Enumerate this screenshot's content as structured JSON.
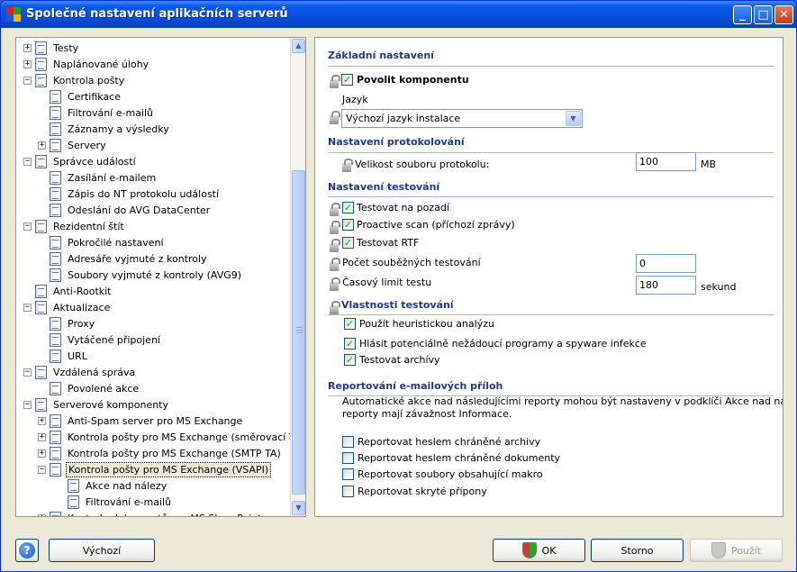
{
  "window": {
    "title": "Společné nastavení aplikačních serverů",
    "minimize": "_",
    "maximize": "□",
    "close": "✕"
  },
  "brand_colors": [
    "#d9232a",
    "#2a9d2a",
    "#1f5bc8",
    "#f2b705"
  ],
  "tree": [
    {
      "label": "Testy",
      "level": 0,
      "expander": "+",
      "icon": "search-icon"
    },
    {
      "label": "Naplánované úlohy",
      "level": 0,
      "expander": "+",
      "icon": "schedule-icon"
    },
    {
      "label": "Kontrola pošty",
      "level": 0,
      "expander": "−",
      "icon": "document-icon"
    },
    {
      "label": "Certifikace",
      "level": 1,
      "expander": "",
      "icon": "document-icon"
    },
    {
      "label": "Filtrování e-mailů",
      "level": 1,
      "expander": "",
      "icon": "document-icon"
    },
    {
      "label": "Záznamy a výsledky",
      "level": 1,
      "expander": "",
      "icon": "document-icon"
    },
    {
      "label": "Servery",
      "level": 1,
      "expander": "+",
      "icon": "server-icon"
    },
    {
      "label": "Správce událostí",
      "level": 0,
      "expander": "−",
      "icon": "document-icon"
    },
    {
      "label": "Zasílání e-mailem",
      "level": 1,
      "expander": "",
      "icon": "document-icon"
    },
    {
      "label": "Zápis do NT protokolu událostí",
      "level": 1,
      "expander": "",
      "icon": "document-icon"
    },
    {
      "label": "Odeslání do AVG DataCenter",
      "level": 1,
      "expander": "",
      "icon": "document-icon"
    },
    {
      "label": "Rezidentní štít",
      "level": 0,
      "expander": "−",
      "icon": "document-icon"
    },
    {
      "label": "Pokročilé nastavení",
      "level": 1,
      "expander": "",
      "icon": "document-icon"
    },
    {
      "label": "Adresáře vyjmuté z kontroly",
      "level": 1,
      "expander": "",
      "icon": "document-icon"
    },
    {
      "label": "Soubory vyjmuté z kontroly (AVG9)",
      "level": 1,
      "expander": "",
      "icon": "document-icon"
    },
    {
      "label": "Anti-Rootkit",
      "level": 0,
      "expander": "",
      "icon": "document-icon"
    },
    {
      "label": "Aktualizace",
      "level": 0,
      "expander": "−",
      "icon": "document-icon"
    },
    {
      "label": "Proxy",
      "level": 1,
      "expander": "",
      "icon": "document-icon"
    },
    {
      "label": "Vytáčené připojení",
      "level": 1,
      "expander": "",
      "icon": "document-icon"
    },
    {
      "label": "URL",
      "level": 1,
      "expander": "",
      "icon": "document-icon"
    },
    {
      "label": "Vzdálená správa",
      "level": 0,
      "expander": "−",
      "icon": "document-icon"
    },
    {
      "label": "Povolené akce",
      "level": 1,
      "expander": "",
      "icon": "document-icon"
    },
    {
      "label": "Serverové komponenty",
      "level": 0,
      "expander": "−",
      "icon": "document-icon"
    },
    {
      "label": "Anti-Spam server pro MS Exchange",
      "level": 1,
      "expander": "+",
      "icon": "document-icon"
    },
    {
      "label": "Kontrola pošty pro MS Exchange (směrovací TA)",
      "level": 1,
      "expander": "+",
      "icon": "document-icon"
    },
    {
      "label": "Kontrola pošty pro MS Exchange (SMTP TA)",
      "level": 1,
      "expander": "+",
      "icon": "document-icon"
    },
    {
      "label": "Kontrola pošty pro MS Exchange (VSAPI)",
      "level": 1,
      "expander": "−",
      "icon": "document-icon",
      "selected": true
    },
    {
      "label": "Akce nad nálezy",
      "level": 2,
      "expander": "",
      "icon": "document-icon"
    },
    {
      "label": "Filtrování e-mailů",
      "level": 2,
      "expander": "",
      "icon": "document-icon"
    },
    {
      "label": "Kontrola dokumentů pro MS SharePoint",
      "level": 1,
      "expander": "+",
      "icon": "document-icon"
    }
  ],
  "settings": {
    "basic_title": "Základní nastavení",
    "enable_component": "Povolit komponentu",
    "language_label": "Jazyk",
    "language_value": "Výchozí jazyk instalace",
    "logging_title": "Nastavení protokolování",
    "log_size_label": "Velikost souboru protokolu:",
    "log_size_value": "100",
    "log_size_unit": "MB",
    "scan_title": "Nastavení testování",
    "scan_background": "Testovat na pozadí",
    "proactive_scan": "Proactive scan (příchozí zprávy)",
    "scan_rtf": "Testovat RTF",
    "concurrent_label": "Počet souběžných testování",
    "concurrent_value": "0",
    "time_limit_label": "Časový limit testu",
    "time_limit_value": "180",
    "time_limit_unit": "sekund",
    "properties_title": "Vlastnosti testování",
    "heuristics": "Použít heuristickou analýzu",
    "pup": "Hlásit potenciálně nežádoucí programy a spyware infekce",
    "archives": "Testovat archívy",
    "reporting_title": "Reportování e-mailových příloh",
    "reporting_desc_1": "Automatické akce nad následujícími reporty mohou být nastaveny v podklíči Akce nad nálezy. Tyto",
    "reporting_desc_2": "reporty mají závažnost Informace.",
    "report_pw_archives": "Reportovat heslem chráněné archivy",
    "report_pw_docs": "Reportovat heslem chráněné dokumenty",
    "report_macro": "Reportovat soubory obsahující makro",
    "report_hidden_ext": "Reportovat skryté přípony",
    "check_mark": "✓"
  },
  "buttons": {
    "help": "?",
    "default": "Výchozí",
    "ok": "OK",
    "cancel": "Storno",
    "apply": "Použít"
  }
}
